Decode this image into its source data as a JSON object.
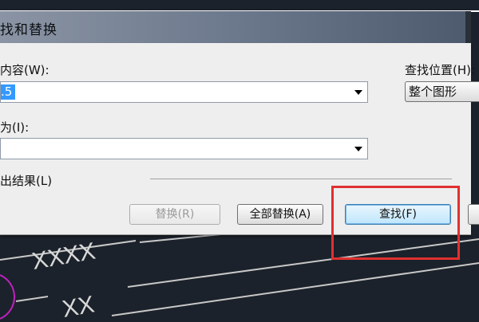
{
  "dialog": {
    "title": "找和替换",
    "find_label": "内容(W):",
    "find_value": ".5",
    "replace_label": "为(I):",
    "replace_value": "",
    "location_label": "查找位置(H):",
    "location_value": "整个图形",
    "results_label": "出结果(L)",
    "buttons": {
      "replace": "替换(R)",
      "replace_all": "全部替换(A)",
      "find": "查找(F)"
    }
  },
  "drawing": {
    "annotation_top": "XXXX",
    "annotation_bottom": "XX"
  },
  "colors": {
    "title_gradient_start": "#8a94a4",
    "dialog_bg": "#eeeeee",
    "selection": "#3399ff",
    "primary_button": "#bee6fd",
    "highlight_box": "#e03030",
    "canvas_bg": "#1c222b"
  }
}
